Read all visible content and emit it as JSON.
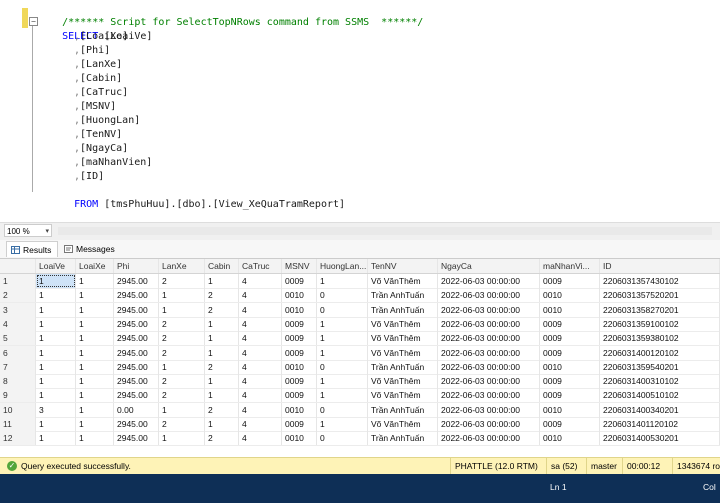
{
  "editor": {
    "comment_line": "/****** Script for SelectTopNRows command from SSMS  ******/",
    "select_keyword": "SELECT",
    "columns": [
      "[LoaiVe]",
      "[LoaiXe]",
      "[Phi]",
      "[LanXe]",
      "[Cabin]",
      "[CaTruc]",
      "[MSNV]",
      "[HuongLan]",
      "[TenNV]",
      "[NgayCa]",
      "[maNhanVien]",
      "[ID]"
    ],
    "from_keyword": "FROM",
    "from_source": "[tmsPhuHuu].[dbo].[View_XeQuaTramReport]"
  },
  "zoom": {
    "value": "100 %"
  },
  "tabs": {
    "results": "Results",
    "messages": "Messages"
  },
  "grid": {
    "headers": [
      "",
      "LoaiVe",
      "LoaiXe",
      "Phi",
      "LanXe",
      "Cabin",
      "CaTruc",
      "MSNV",
      "HuongLan...",
      "TenNV",
      "NgayCa",
      "maNhanVi...",
      "ID"
    ],
    "rows": [
      [
        "1",
        "1",
        "1",
        "2945.00",
        "2",
        "1",
        "4",
        "0009",
        "1",
        "Võ VănThêm",
        "2022-06-03 00:00:00",
        "0009",
        "2206031357430102"
      ],
      [
        "2",
        "1",
        "1",
        "2945.00",
        "1",
        "2",
        "4",
        "0010",
        "0",
        "Trần AnhTuấn",
        "2022-06-03 00:00:00",
        "0010",
        "2206031357520201"
      ],
      [
        "3",
        "1",
        "1",
        "2945.00",
        "1",
        "2",
        "4",
        "0010",
        "0",
        "Trần AnhTuấn",
        "2022-06-03 00:00:00",
        "0010",
        "2206031358270201"
      ],
      [
        "4",
        "1",
        "1",
        "2945.00",
        "2",
        "1",
        "4",
        "0009",
        "1",
        "Võ VănThêm",
        "2022-06-03 00:00:00",
        "0009",
        "2206031359100102"
      ],
      [
        "5",
        "1",
        "1",
        "2945.00",
        "2",
        "1",
        "4",
        "0009",
        "1",
        "Võ VănThêm",
        "2022-06-03 00:00:00",
        "0009",
        "2206031359380102"
      ],
      [
        "6",
        "1",
        "1",
        "2945.00",
        "2",
        "1",
        "4",
        "0009",
        "1",
        "Võ VănThêm",
        "2022-06-03 00:00:00",
        "0009",
        "2206031400120102"
      ],
      [
        "7",
        "1",
        "1",
        "2945.00",
        "1",
        "2",
        "4",
        "0010",
        "0",
        "Trần AnhTuấn",
        "2022-06-03 00:00:00",
        "0010",
        "2206031359540201"
      ],
      [
        "8",
        "1",
        "1",
        "2945.00",
        "2",
        "1",
        "4",
        "0009",
        "1",
        "Võ VănThêm",
        "2022-06-03 00:00:00",
        "0009",
        "2206031400310102"
      ],
      [
        "9",
        "1",
        "1",
        "2945.00",
        "2",
        "1",
        "4",
        "0009",
        "1",
        "Võ VănThêm",
        "2022-06-03 00:00:00",
        "0009",
        "2206031400510102"
      ],
      [
        "10",
        "3",
        "1",
        "0.00",
        "1",
        "2",
        "4",
        "0010",
        "0",
        "Trần AnhTuấn",
        "2022-06-03 00:00:00",
        "0010",
        "2206031400340201"
      ],
      [
        "11",
        "1",
        "1",
        "2945.00",
        "2",
        "1",
        "4",
        "0009",
        "1",
        "Võ VănThêm",
        "2022-06-03 00:00:00",
        "0009",
        "2206031401120102"
      ],
      [
        "12",
        "1",
        "1",
        "2945.00",
        "1",
        "2",
        "4",
        "0010",
        "0",
        "Trần AnhTuấn",
        "2022-06-03 00:00:00",
        "0010",
        "2206031400530201"
      ]
    ]
  },
  "status": {
    "message": "Query executed successfully.",
    "server": "PHATTLE (12.0 RTM)",
    "user": "sa (52)",
    "database": "master",
    "elapsed": "00:00:12",
    "rows": "1343674 ro"
  },
  "bottombar": {
    "line": "Ln 1",
    "col": "Col"
  },
  "colors": {
    "status_bg": "#fef3b7",
    "bottombar_bg": "#0e2f56",
    "keyword": "#0000ff",
    "comment": "#008000"
  }
}
